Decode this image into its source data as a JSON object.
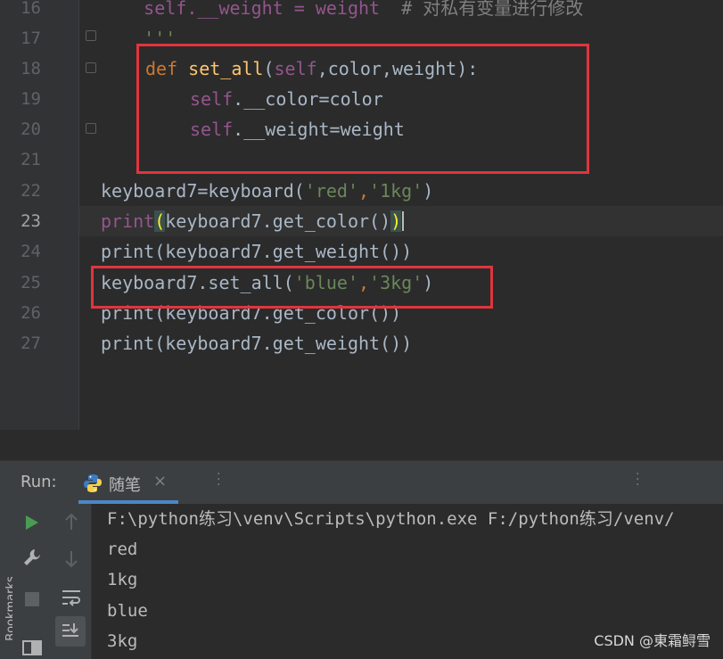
{
  "editor": {
    "line_numbers": [
      "16",
      "17",
      "18",
      "19",
      "20",
      "21",
      "22",
      "23",
      "24",
      "25",
      "26",
      "27"
    ],
    "current_line": "23",
    "lines": {
      "l16_a": "    self.__weight = weight  ",
      "l16_b": "# 对私有变量进行修改",
      "l17": "    '''",
      "l18_def": "def ",
      "l18_fn": "set_all",
      "l18_open": "(",
      "l18_self": "self",
      "l18_rest": ",color,weight):",
      "l19_self": "self",
      "l19_rest": ".__color=color",
      "l20_self": "self",
      "l20_rest": ".__weight=weight",
      "l22_a": "keyboard7=keyboard(",
      "l22_s1": "'red'",
      "l22_comma": ",",
      "l22_s2": "'1kg'",
      "l22_close": ")",
      "l23_a": "print",
      "l23_open": "(",
      "l23_mid": "keyboard7.get_color()",
      "l23_close": ")",
      "l24": "print(keyboard7.get_weight())",
      "l25_a": "keyboard7.set_all(",
      "l25_s1": "'blue'",
      "l25_comma": ",",
      "l25_s2": "'3kg'",
      "l25_close": ")",
      "l26": "print(keyboard7.get_color())",
      "l27": "print(keyboard7.get_weight())"
    }
  },
  "run": {
    "title": "Run:",
    "tab_label": "随笔",
    "tab_close": "×",
    "console_lines": [
      "F:\\python练习\\venv\\Scripts\\python.exe F:/python练习/venv/",
      "red",
      "1kg",
      "blue",
      "3kg"
    ]
  },
  "sidebar": {
    "bookmarks_label": "Bookmarks"
  },
  "watermark": "CSDN @東霜鲟雪",
  "colors": {
    "keyword": "#cc7832",
    "function": "#ffc66d",
    "self": "#94558d",
    "string": "#6a8759",
    "comment": "#808080",
    "annotation_box": "#e0353e",
    "run_icon": "#499c54"
  }
}
